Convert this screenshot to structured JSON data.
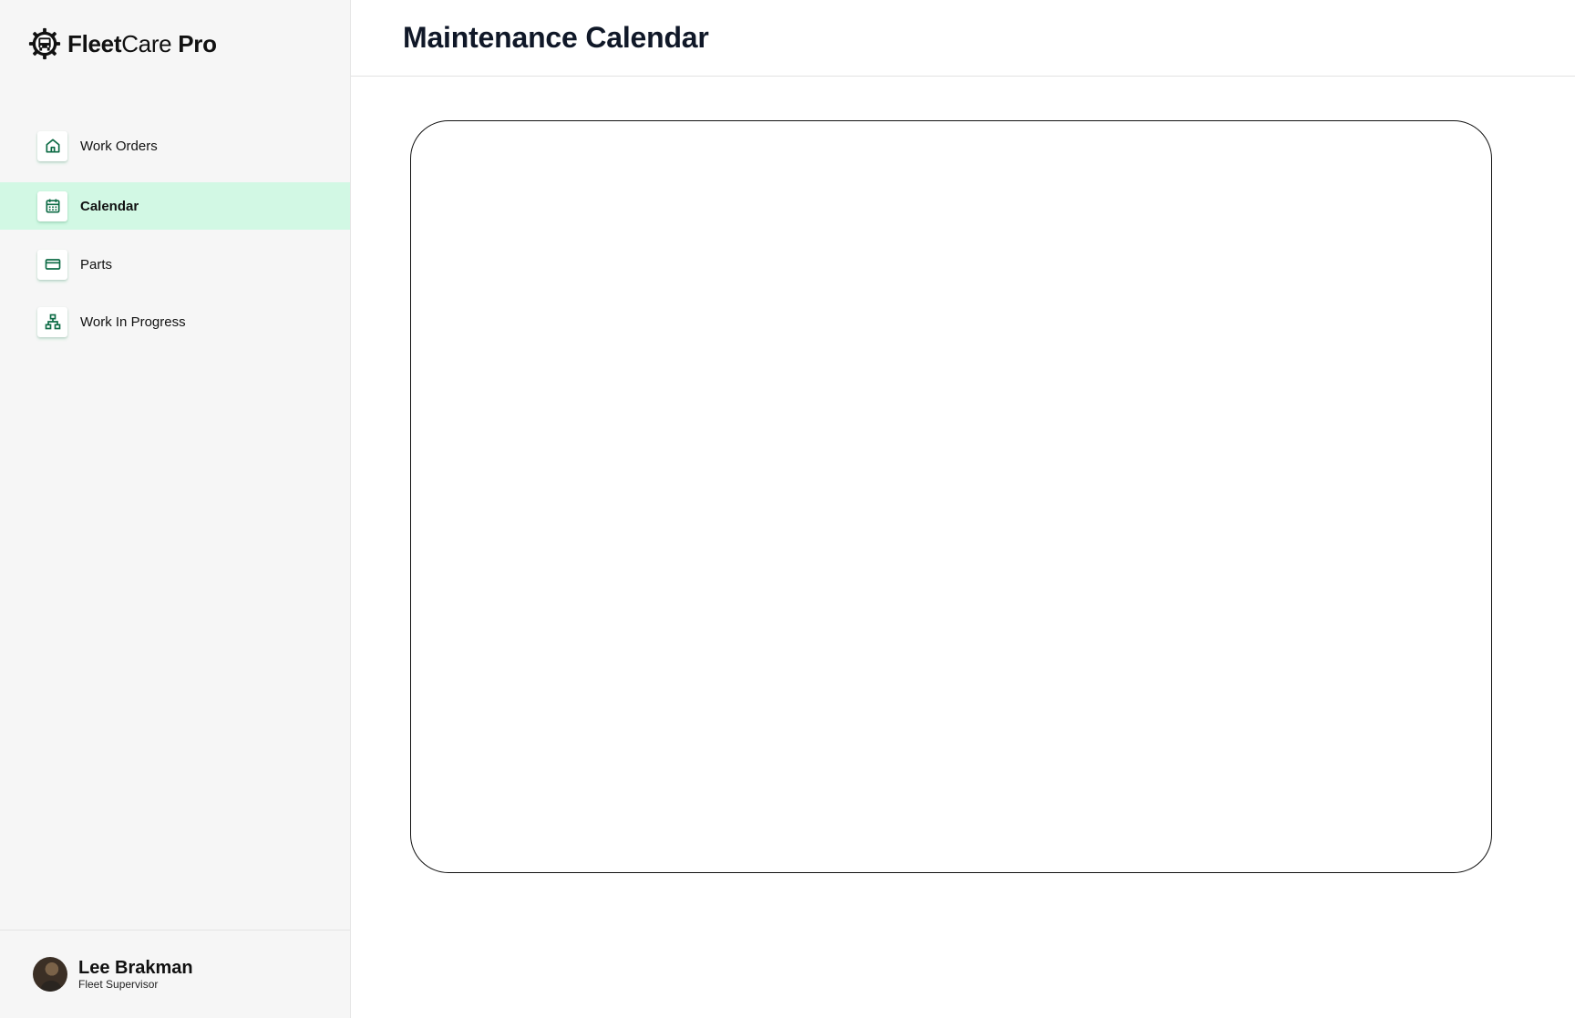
{
  "brand": {
    "part1": "Fleet",
    "part2": "Care",
    "part3": " Pro",
    "logo_icon": "gear-bus-icon"
  },
  "sidebar": {
    "items": [
      {
        "label": "Work Orders",
        "icon": "home-icon",
        "active": false
      },
      {
        "label": "Calendar",
        "icon": "calendar-icon",
        "active": true
      },
      {
        "label": "Parts",
        "icon": "credit-card-icon",
        "active": false
      },
      {
        "label": "Work In Progress",
        "icon": "hierarchy-icon",
        "active": false
      }
    ],
    "accent_color": "#0d6b45",
    "active_bg": "#d2f8e4"
  },
  "user": {
    "name": "Lee Brakman",
    "role": "Fleet Supervisor"
  },
  "header": {
    "title": "Maintenance Calendar"
  }
}
